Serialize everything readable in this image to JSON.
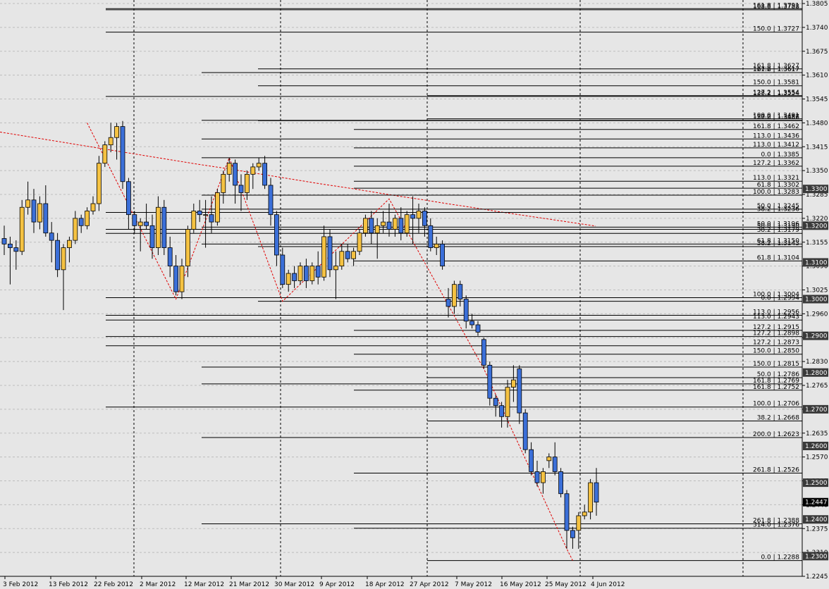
{
  "chart_data": {
    "type": "candlestick",
    "ylim": [
      1.2245,
      1.3805
    ],
    "grid": true,
    "y_ticks": [
      "1.3805",
      "1.3740",
      "1.3675",
      "1.3610",
      "1.3545",
      "1.3480",
      "1.3415",
      "1.3350",
      "1.3285",
      "1.3220",
      "1.3155",
      "1.3090",
      "1.3025",
      "1.2960",
      "1.2895",
      "1.2830",
      "1.2765",
      "1.2700",
      "1.2635",
      "1.2570",
      "1.2505",
      "1.2440",
      "1.2375",
      "1.2310",
      "1.2245"
    ],
    "x_tick_labels": [
      "3 Feb 2012",
      "13 Feb 2012",
      "22 Feb 2012",
      "2 Mar 2012",
      "12 Mar 2012",
      "21 Mar 2012",
      "30 Mar 2012",
      "9 Apr 2012",
      "18 Apr 2012",
      "27 Apr 2012",
      "7 May 2012",
      "16 May 2012",
      "25 May 2012",
      "4 Jun 2012"
    ],
    "price_boxes": [
      {
        "label": "1.3300",
        "value": 1.33,
        "style": "dark"
      },
      {
        "label": "1.3200",
        "value": 1.32,
        "style": "dark"
      },
      {
        "label": "1.3100",
        "value": 1.31,
        "style": "dark"
      },
      {
        "label": "1.3000",
        "value": 1.3,
        "style": "dark"
      },
      {
        "label": "1.2900",
        "value": 1.29,
        "style": "dark"
      },
      {
        "label": "1.2800",
        "value": 1.28,
        "style": "dark"
      },
      {
        "label": "1.2700",
        "value": 1.27,
        "style": "dark"
      },
      {
        "label": "1.2600",
        "value": 1.26,
        "style": "dark"
      },
      {
        "label": "1.2500",
        "value": 1.25,
        "style": "dark"
      },
      {
        "label": "1.2447",
        "value": 1.2447,
        "style": "current"
      },
      {
        "label": "1.2400",
        "value": 1.24,
        "style": "dark"
      },
      {
        "label": "1.2300",
        "value": 1.23,
        "style": "dark"
      }
    ],
    "fib_levels": [
      {
        "text": "161.8 | 1.3791",
        "start": "22 Feb 2012",
        "value": 1.3791
      },
      {
        "text": "168.8 | 1.3788",
        "start": "13 Feb 2012",
        "value": 1.3788
      },
      {
        "text": "150.0 | 1.3727",
        "start": "13 Feb 2012",
        "value": 1.3727
      },
      {
        "text": "161.8 | 1.3627",
        "start": "21 Mar 2012",
        "value": 1.3627
      },
      {
        "text": "161.8 | 1.3617",
        "start": "12 Mar 2012",
        "value": 1.3617
      },
      {
        "text": "127.2 | 1.3617",
        "start": "21 Mar 2012",
        "value": 1.3617
      },
      {
        "text": "150.0 | 1.3581",
        "start": "21 Mar 2012",
        "value": 1.3581
      },
      {
        "text": "127.2 | 1.3554",
        "start": "27 Apr 2012",
        "value": 1.3554
      },
      {
        "text": "138.2 | 1.3554",
        "start": "3 Feb 2012",
        "value": 1.3552
      },
      {
        "text": "127.2 | 1.3487",
        "start": "12 Mar 2012",
        "value": 1.3487
      },
      {
        "text": "100.0 | 1.3491",
        "start": "27 Apr 2012",
        "value": 1.3491
      },
      {
        "text": "150.0 | 1.3486",
        "start": "21 Mar 2012",
        "value": 1.3486
      },
      {
        "text": "161.8 | 1.3462",
        "start": "18 Apr 2012",
        "value": 1.3462
      },
      {
        "text": "113.0 | 1.3436",
        "start": "12 Mar 2012",
        "value": 1.3436
      },
      {
        "text": "113.0 | 1.3412",
        "start": "18 Apr 2012",
        "value": 1.3412
      },
      {
        "text": "0.0 | 1.3385",
        "start": "12 Mar 2012",
        "value": 1.3385
      },
      {
        "text": "127.2 | 1.3362",
        "start": "18 Apr 2012",
        "value": 1.3362
      },
      {
        "text": "113.0 | 1.3321",
        "start": "18 Apr 2012",
        "value": 1.3321
      },
      {
        "text": "61.8 | 1.3302",
        "start": "18 Apr 2012",
        "value": 1.3302
      },
      {
        "text": "100.0 | 1.3283",
        "start": "12 Mar 2012",
        "value": 1.3283
      },
      {
        "text": "50.0 | 1.3245",
        "start": "12 Mar 2012",
        "value": 1.3245
      },
      {
        "text": "38.2 | 1.3236",
        "start": "22 Feb 2012",
        "value": 1.3236
      },
      {
        "text": "50.0 | 1.3196",
        "start": "12 Mar 2012",
        "value": 1.3196
      },
      {
        "text": "50.0 | 1.3190",
        "start": "22 Feb 2012",
        "value": 1.319
      },
      {
        "text": "38.2 | 1.3179",
        "start": "22 Feb 2012",
        "value": 1.3179
      },
      {
        "text": "61.8 | 1.3150",
        "start": "12 Mar 2012",
        "value": 1.315
      },
      {
        "text": "38.2 | 1.3143",
        "start": "30 Mar 2012",
        "value": 1.3143
      },
      {
        "text": "61.8 | 1.3104",
        "start": "18 Apr 2012",
        "value": 1.3104
      },
      {
        "text": "100.0 | 1.3004",
        "start": "3 Feb 2012",
        "value": 1.3004
      },
      {
        "text": "0.0 | 1.2994",
        "start": "30 Mar 2012",
        "value": 1.2994
      },
      {
        "text": "113.0 | 1.2956",
        "start": "3 Feb 2012",
        "value": 1.2956
      },
      {
        "text": "113.0 | 1.2943",
        "start": "3 Feb 2012",
        "value": 1.2943
      },
      {
        "text": "127.2 | 1.2915",
        "start": "18 Apr 2012",
        "value": 1.2915
      },
      {
        "text": "127.2 | 1.2898",
        "start": "3 Feb 2012",
        "value": 1.2898
      },
      {
        "text": "127.2 | 1.2873",
        "start": "22 Feb 2012",
        "value": 1.2873
      },
      {
        "text": "150.0 | 1.2850",
        "start": "18 Apr 2012",
        "value": 1.285
      },
      {
        "text": "150.0 | 1.2815",
        "start": "12 Mar 2012",
        "value": 1.2815
      },
      {
        "text": "50.0 | 1.2786",
        "start": "27 Apr 2012",
        "value": 1.2786
      },
      {
        "text": "161.8 | 1.2769",
        "start": "12 Mar 2012",
        "value": 1.2769
      },
      {
        "text": "161.8 | 1.2752",
        "start": "18 Apr 2012",
        "value": 1.2752
      },
      {
        "text": "100.0 | 1.2706",
        "start": "22 Feb 2012",
        "value": 1.2706
      },
      {
        "text": "38.2 | 1.2668",
        "start": "27 Apr 2012",
        "value": 1.2668
      },
      {
        "text": "200.0 | 1.2623",
        "start": "12 Mar 2012",
        "value": 1.2623
      },
      {
        "text": "261.8 | 1.2526",
        "start": "18 Apr 2012",
        "value": 1.2526
      },
      {
        "text": "261.8 | 1.2388",
        "start": "12 Mar 2012",
        "value": 1.2388
      },
      {
        "text": "314.0 | 1.2376",
        "start": "18 Apr 2012",
        "value": 1.2376
      },
      {
        "text": "0.0 | 1.2288",
        "start": "27 Apr 2012",
        "value": 1.2288
      }
    ],
    "candles": [
      {
        "x": "2 Feb",
        "o": 1.3165,
        "h": 1.32,
        "l": 1.312,
        "c": 1.315
      },
      {
        "x": "3 Feb",
        "o": 1.315,
        "h": 1.317,
        "l": 1.304,
        "c": 1.314
      },
      {
        "x": "6 Feb",
        "o": 1.314,
        "h": 1.316,
        "l": 1.308,
        "c": 1.313
      },
      {
        "x": "7 Feb",
        "o": 1.313,
        "h": 1.327,
        "l": 1.312,
        "c": 1.325
      },
      {
        "x": "8 Feb",
        "o": 1.325,
        "h": 1.332,
        "l": 1.323,
        "c": 1.327
      },
      {
        "x": "9 Feb",
        "o": 1.327,
        "h": 1.33,
        "l": 1.318,
        "c": 1.321
      },
      {
        "x": "10 Feb",
        "o": 1.321,
        "h": 1.328,
        "l": 1.319,
        "c": 1.326
      },
      {
        "x": "13 Feb",
        "o": 1.326,
        "h": 1.331,
        "l": 1.317,
        "c": 1.318
      },
      {
        "x": "14 Feb",
        "o": 1.318,
        "h": 1.321,
        "l": 1.31,
        "c": 1.316
      },
      {
        "x": "15 Feb",
        "o": 1.316,
        "h": 1.318,
        "l": 1.306,
        "c": 1.308
      },
      {
        "x": "16 Feb",
        "o": 1.308,
        "h": 1.315,
        "l": 1.297,
        "c": 1.314
      },
      {
        "x": "17 Feb",
        "o": 1.314,
        "h": 1.317,
        "l": 1.31,
        "c": 1.316
      },
      {
        "x": "20 Feb",
        "o": 1.316,
        "h": 1.324,
        "l": 1.315,
        "c": 1.322
      },
      {
        "x": "21 Feb",
        "o": 1.322,
        "h": 1.323,
        "l": 1.318,
        "c": 1.32
      },
      {
        "x": "22 Feb",
        "o": 1.32,
        "h": 1.325,
        "l": 1.319,
        "c": 1.324
      },
      {
        "x": "23 Feb",
        "o": 1.324,
        "h": 1.328,
        "l": 1.323,
        "c": 1.326
      },
      {
        "x": "24 Feb",
        "o": 1.326,
        "h": 1.339,
        "l": 1.324,
        "c": 1.337
      },
      {
        "x": "27 Feb",
        "o": 1.337,
        "h": 1.343,
        "l": 1.336,
        "c": 1.342
      },
      {
        "x": "28 Feb",
        "o": 1.342,
        "h": 1.348,
        "l": 1.34,
        "c": 1.344
      },
      {
        "x": "29 Feb",
        "o": 1.344,
        "h": 1.348,
        "l": 1.338,
        "c": 1.347
      },
      {
        "x": "1 Mar",
        "o": 1.347,
        "h": 1.3485,
        "l": 1.33,
        "c": 1.332
      },
      {
        "x": "2 Mar",
        "o": 1.332,
        "h": 1.333,
        "l": 1.319,
        "c": 1.323
      },
      {
        "x": "5 Mar",
        "o": 1.323,
        "h": 1.324,
        "l": 1.318,
        "c": 1.32
      },
      {
        "x": "6 Mar",
        "o": 1.32,
        "h": 1.322,
        "l": 1.313,
        "c": 1.321
      },
      {
        "x": "7 Mar",
        "o": 1.321,
        "h": 1.326,
        "l": 1.319,
        "c": 1.32
      },
      {
        "x": "8 Mar",
        "o": 1.32,
        "h": 1.323,
        "l": 1.311,
        "c": 1.314
      },
      {
        "x": "9 Mar",
        "o": 1.314,
        "h": 1.328,
        "l": 1.312,
        "c": 1.325
      },
      {
        "x": "12 Mar",
        "o": 1.325,
        "h": 1.327,
        "l": 1.312,
        "c": 1.314
      },
      {
        "x": "13 Mar",
        "o": 1.314,
        "h": 1.317,
        "l": 1.306,
        "c": 1.309
      },
      {
        "x": "14 Mar",
        "o": 1.309,
        "h": 1.312,
        "l": 1.301,
        "c": 1.302
      },
      {
        "x": "15 Mar",
        "o": 1.302,
        "h": 1.311,
        "l": 1.3,
        "c": 1.309
      },
      {
        "x": "16 Mar",
        "o": 1.309,
        "h": 1.32,
        "l": 1.306,
        "c": 1.319
      },
      {
        "x": "19 Mar",
        "o": 1.319,
        "h": 1.326,
        "l": 1.318,
        "c": 1.324
      },
      {
        "x": "20 Mar",
        "o": 1.324,
        "h": 1.327,
        "l": 1.321,
        "c": 1.323
      },
      {
        "x": "21 Mar",
        "o": 1.323,
        "h": 1.327,
        "l": 1.314,
        "c": 1.323
      },
      {
        "x": "22 Mar",
        "o": 1.323,
        "h": 1.328,
        "l": 1.318,
        "c": 1.321
      },
      {
        "x": "23 Mar",
        "o": 1.321,
        "h": 1.33,
        "l": 1.32,
        "c": 1.329
      },
      {
        "x": "26 Mar",
        "o": 1.329,
        "h": 1.335,
        "l": 1.326,
        "c": 1.334
      },
      {
        "x": "27 Mar",
        "o": 1.334,
        "h": 1.3385,
        "l": 1.332,
        "c": 1.337
      },
      {
        "x": "28 Mar",
        "o": 1.337,
        "h": 1.338,
        "l": 1.326,
        "c": 1.331
      },
      {
        "x": "29 Mar",
        "o": 1.331,
        "h": 1.334,
        "l": 1.324,
        "c": 1.329
      },
      {
        "x": "30 Mar",
        "o": 1.329,
        "h": 1.335,
        "l": 1.327,
        "c": 1.334
      },
      {
        "x": "2 Apr",
        "o": 1.334,
        "h": 1.337,
        "l": 1.33,
        "c": 1.336
      },
      {
        "x": "3 Apr",
        "o": 1.336,
        "h": 1.3385,
        "l": 1.335,
        "c": 1.337
      },
      {
        "x": "4 Apr",
        "o": 1.337,
        "h": 1.339,
        "l": 1.33,
        "c": 1.331
      },
      {
        "x": "5 Apr",
        "o": 1.331,
        "h": 1.333,
        "l": 1.32,
        "c": 1.323
      },
      {
        "x": "6 Apr",
        "o": 1.323,
        "h": 1.324,
        "l": 1.309,
        "c": 1.312
      },
      {
        "x": "9 Apr",
        "o": 1.312,
        "h": 1.314,
        "l": 1.303,
        "c": 1.304
      },
      {
        "x": "10 Apr",
        "o": 1.304,
        "h": 1.308,
        "l": 1.302,
        "c": 1.307
      },
      {
        "x": "11 Apr",
        "o": 1.307,
        "h": 1.309,
        "l": 1.303,
        "c": 1.305
      },
      {
        "x": "12 Apr",
        "o": 1.305,
        "h": 1.31,
        "l": 1.304,
        "c": 1.309
      },
      {
        "x": "13 Apr",
        "o": 1.309,
        "h": 1.311,
        "l": 1.303,
        "c": 1.305
      },
      {
        "x": "16 Apr",
        "o": 1.305,
        "h": 1.31,
        "l": 1.304,
        "c": 1.309
      },
      {
        "x": "17 Apr",
        "o": 1.309,
        "h": 1.313,
        "l": 1.304,
        "c": 1.306
      },
      {
        "x": "18 Apr",
        "o": 1.306,
        "h": 1.32,
        "l": 1.305,
        "c": 1.317
      },
      {
        "x": "19 Apr",
        "o": 1.317,
        "h": 1.319,
        "l": 1.306,
        "c": 1.308
      },
      {
        "x": "20 Apr",
        "o": 1.308,
        "h": 1.313,
        "l": 1.3,
        "c": 1.309
      },
      {
        "x": "23 Apr",
        "o": 1.309,
        "h": 1.315,
        "l": 1.308,
        "c": 1.313
      },
      {
        "x": "24 Apr",
        "o": 1.313,
        "h": 1.315,
        "l": 1.31,
        "c": 1.311
      },
      {
        "x": "25 Apr",
        "o": 1.311,
        "h": 1.314,
        "l": 1.309,
        "c": 1.313
      },
      {
        "x": "26 Apr",
        "o": 1.313,
        "h": 1.319,
        "l": 1.312,
        "c": 1.318
      },
      {
        "x": "27 Apr",
        "o": 1.318,
        "h": 1.323,
        "l": 1.317,
        "c": 1.322
      },
      {
        "x": "30 Apr",
        "o": 1.322,
        "h": 1.324,
        "l": 1.315,
        "c": 1.318
      },
      {
        "x": "1 May",
        "o": 1.318,
        "h": 1.322,
        "l": 1.311,
        "c": 1.32
      },
      {
        "x": "2 May",
        "o": 1.32,
        "h": 1.324,
        "l": 1.318,
        "c": 1.321
      },
      {
        "x": "3 May",
        "o": 1.321,
        "h": 1.326,
        "l": 1.317,
        "c": 1.319
      },
      {
        "x": "4 May",
        "o": 1.319,
        "h": 1.323,
        "l": 1.317,
        "c": 1.322
      },
      {
        "x": "7 May",
        "o": 1.322,
        "h": 1.325,
        "l": 1.316,
        "c": 1.318
      },
      {
        "x": "8 May",
        "o": 1.318,
        "h": 1.324,
        "l": 1.317,
        "c": 1.323
      },
      {
        "x": "9 May",
        "o": 1.323,
        "h": 1.328,
        "l": 1.315,
        "c": 1.322
      },
      {
        "x": "10 May",
        "o": 1.322,
        "h": 1.326,
        "l": 1.318,
        "c": 1.324
      },
      {
        "x": "11 May",
        "o": 1.324,
        "h": 1.325,
        "l": 1.317,
        "c": 1.32
      },
      {
        "x": "14 May",
        "o": 1.32,
        "h": 1.322,
        "l": 1.313,
        "c": 1.314
      },
      {
        "x": "15 May",
        "o": 1.314,
        "h": 1.317,
        "l": 1.312,
        "c": 1.315
      },
      {
        "x": "16 May",
        "o": 1.315,
        "h": 1.316,
        "l": 1.308,
        "c": 1.309
      },
      {
        "x": "17 May",
        "o": 1.3,
        "h": 1.303,
        "l": 1.295,
        "c": 1.298
      },
      {
        "x": "18 May",
        "o": 1.298,
        "h": 1.305,
        "l": 1.296,
        "c": 1.304
      },
      {
        "x": "21 May",
        "o": 1.304,
        "h": 1.305,
        "l": 1.298,
        "c": 1.3
      },
      {
        "x": "22 May",
        "o": 1.3,
        "h": 1.301,
        "l": 1.292,
        "c": 1.294
      },
      {
        "x": "23 May",
        "o": 1.294,
        "h": 1.296,
        "l": 1.292,
        "c": 1.293
      },
      {
        "x": "24 May",
        "o": 1.293,
        "h": 1.294,
        "l": 1.29,
        "c": 1.291
      },
      {
        "x": "25 May",
        "o": 1.289,
        "h": 1.2895,
        "l": 1.281,
        "c": 1.282
      },
      {
        "x": "28 May",
        "o": 1.282,
        "h": 1.283,
        "l": 1.271,
        "c": 1.273
      },
      {
        "x": "29 May",
        "o": 1.273,
        "h": 1.274,
        "l": 1.268,
        "c": 1.271
      },
      {
        "x": "30 May",
        "o": 1.271,
        "h": 1.272,
        "l": 1.265,
        "c": 1.268
      },
      {
        "x": "31 May",
        "o": 1.268,
        "h": 1.278,
        "l": 1.265,
        "c": 1.276
      },
      {
        "x": "1 Jun",
        "o": 1.276,
        "h": 1.282,
        "l": 1.272,
        "c": 1.278
      },
      {
        "x": "4 Jun",
        "o": 1.281,
        "h": 1.282,
        "l": 1.266,
        "c": 1.269
      },
      {
        "x": "5 Jun",
        "o": 1.269,
        "h": 1.27,
        "l": 1.258,
        "c": 1.259
      },
      {
        "x": "6 Jun",
        "o": 1.259,
        "h": 1.261,
        "l": 1.252,
        "c": 1.253
      },
      {
        "x": "7 Jun",
        "o": 1.253,
        "h": 1.256,
        "l": 1.249,
        "c": 1.25
      },
      {
        "x": "8 Jun",
        "o": 1.25,
        "h": 1.254,
        "l": 1.247,
        "c": 1.253
      },
      {
        "x": "11 Jun",
        "o": 1.256,
        "h": 1.258,
        "l": 1.254,
        "c": 1.257
      },
      {
        "x": "12 Jun",
        "o": 1.257,
        "h": 1.261,
        "l": 1.252,
        "c": 1.253
      },
      {
        "x": "13 Jun",
        "o": 1.253,
        "h": 1.254,
        "l": 1.246,
        "c": 1.247
      },
      {
        "x": "14 Jun",
        "o": 1.247,
        "h": 1.248,
        "l": 1.232,
        "c": 1.237
      },
      {
        "x": "15 Jun",
        "o": 1.237,
        "h": 1.238,
        "l": 1.232,
        "c": 1.235
      },
      {
        "x": "18 Jun",
        "o": 1.237,
        "h": 1.242,
        "l": 1.232,
        "c": 1.241
      },
      {
        "x": "19 Jun",
        "o": 1.241,
        "h": 1.244,
        "l": 1.24,
        "c": 1.242
      },
      {
        "x": "20 Jun",
        "o": 1.242,
        "h": 1.251,
        "l": 1.24,
        "c": 1.25
      },
      {
        "x": "21 Jun",
        "o": 1.25,
        "h": 1.254,
        "l": 1.241,
        "c": 1.2447
      }
    ],
    "moving_average": [
      1.3455,
      1.3444,
      1.3433,
      1.3422,
      1.3411,
      1.34,
      1.3389,
      1.3378,
      1.3367,
      1.3357,
      1.3346,
      1.3335,
      1.3324,
      1.3313,
      1.3303,
      1.3292,
      1.3281,
      1.3271,
      1.326,
      1.325,
      1.3239,
      1.3229,
      1.3219,
      1.3209,
      1.3199
    ],
    "zigzag": [
      [
        "22 Feb",
        1.348
      ],
      [
        "14 Mar",
        1.3
      ],
      [
        "27 Mar",
        1.3385
      ],
      [
        "9 Apr",
        1.2994
      ],
      [
        "3 May",
        1.3273
      ],
      [
        "25 May",
        1.281
      ],
      [
        "14 Jun",
        1.232
      ],
      [
        "15 Jun",
        1.2288
      ]
    ]
  }
}
